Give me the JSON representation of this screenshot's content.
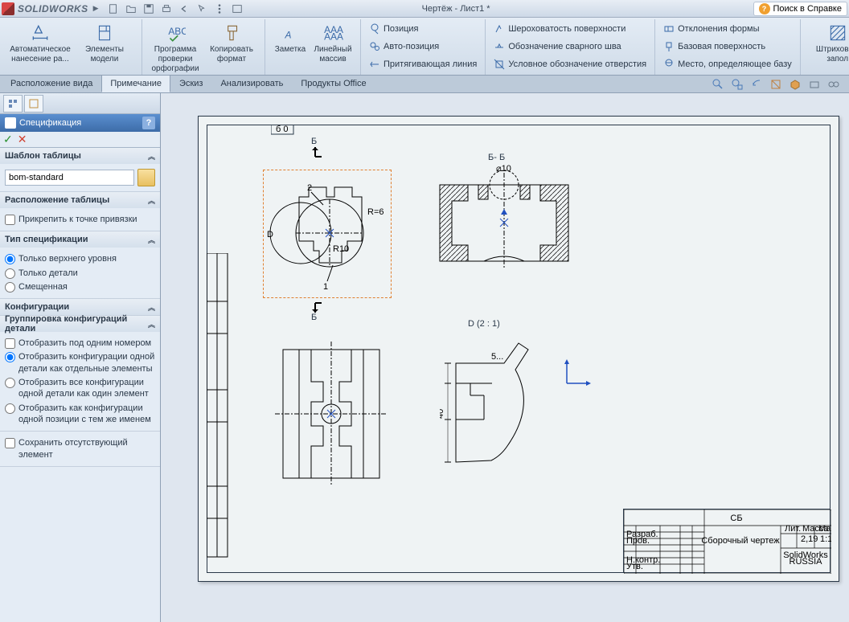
{
  "app": {
    "name": "SOLIDWORKS",
    "doc_title": "Чертёж - Лист1 *",
    "search_placeholder": "Поиск в Справке"
  },
  "ribbon": {
    "auto_dim": "Автоматическое нанесение ра...",
    "model_items": "Элементы модели",
    "spellcheck": "Программа проверки орфографии",
    "copy_format": "Копировать формат",
    "note": "Заметка",
    "linear_pattern": "Линейный массив",
    "position": "Позиция",
    "auto_position": "Авто-позиция",
    "magnetic_line": "Притягивающая линия",
    "surface_finish": "Шероховатость поверхности",
    "weld_symbol": "Обозначение сварного шва",
    "hole_callout": "Условное обозначение отверстия",
    "form_tolerance": "Отклонения формы",
    "datum_surface": "Базовая поверхность",
    "datum_target": "Место, определяющее базу",
    "hatch_fill": "Штриховка/запол"
  },
  "tabs": {
    "view_layout": "Расположение вида",
    "annotation": "Примечание",
    "sketch": "Эскиз",
    "analyze": "Анализировать",
    "office": "Продукты Office"
  },
  "pm": {
    "title": "Спецификация",
    "template_hdr": "Шаблон таблицы",
    "template_val": "bom-standard",
    "table_loc_hdr": "Расположение таблицы",
    "attach_anchor": "Прикрепить к точке привязки",
    "bom_type_hdr": "Тип спецификации",
    "top_level": "Только верхнего уровня",
    "parts_only": "Только детали",
    "indented": "Смещенная",
    "configs_hdr": "Конфигурации",
    "part_config_hdr": "Группировка конфигураций детали",
    "display_one": "Отобразить под одним номером",
    "display_sep": "Отобразить конфигурации одной детали как отдельные элементы",
    "display_one_item": "Отобразить все конфигурации одной детали как один элемент",
    "display_same_name": "Отобразить как конфигурации одной позиции с тем же именем",
    "keep_missing": "Сохранить отсутствующий элемент"
  },
  "drawing": {
    "section_bb": "Б- Б",
    "detail_b_top": "Б",
    "detail_b_bot": "Б",
    "detail_d": "D",
    "detail_d_label": "D  (2 : 1)",
    "title_sb": "СБ",
    "title_assy": "Сборочный чертеж",
    "title_sw": "SolidWorks RUSSIA"
  }
}
